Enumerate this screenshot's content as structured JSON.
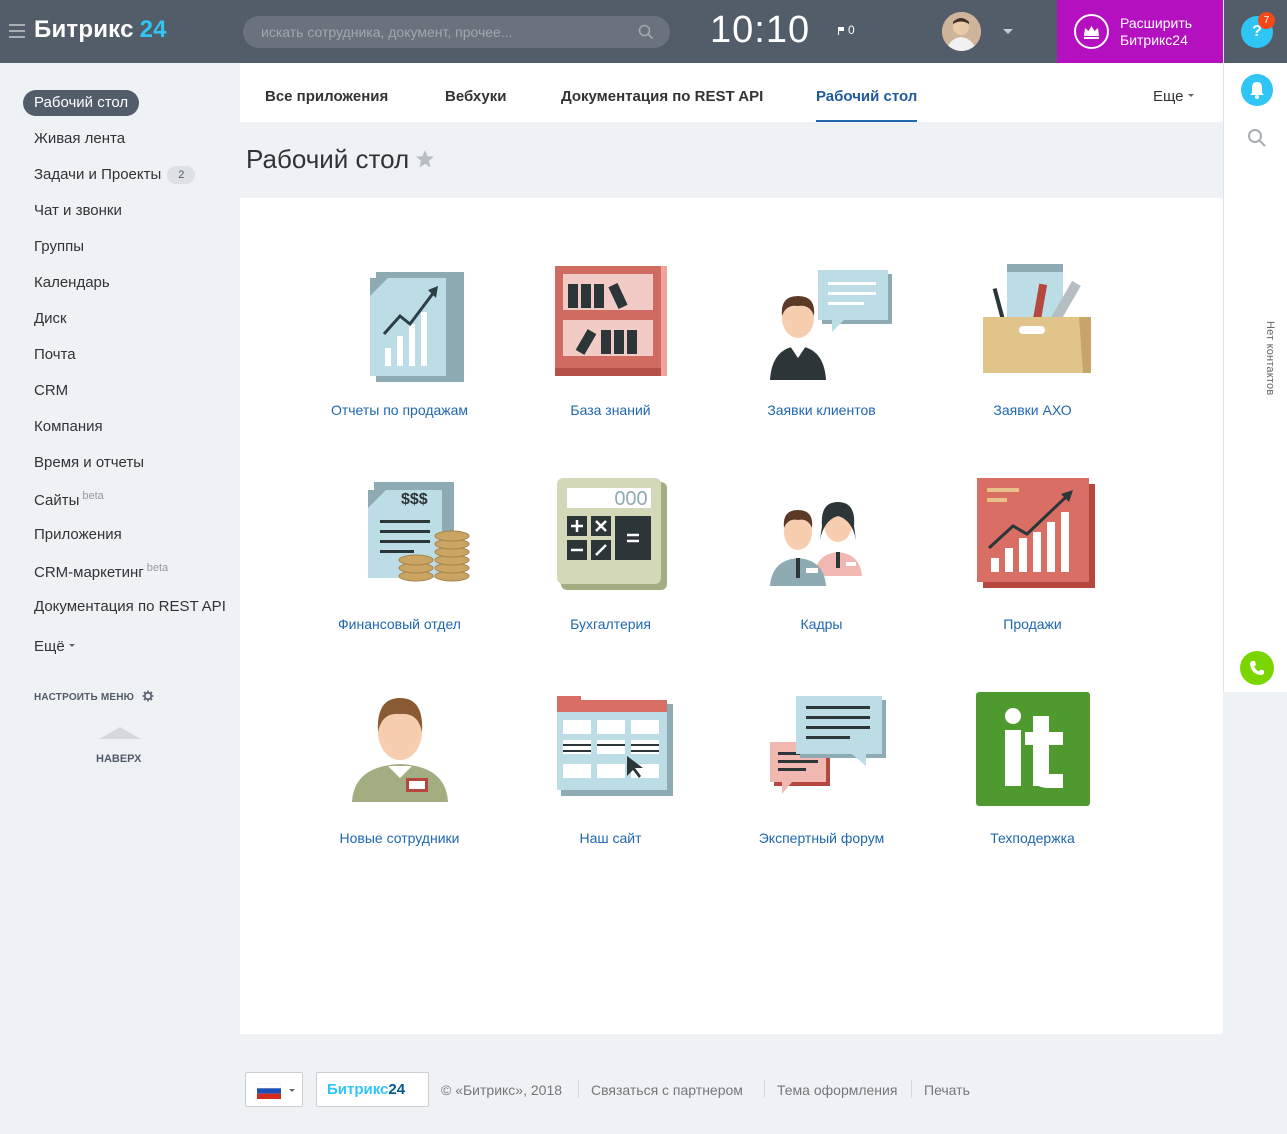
{
  "header": {
    "logo_main": "Битрикс",
    "logo_num": "24",
    "search_placeholder": "искать сотрудника, документ, прочее...",
    "clock": "10:10",
    "flag_count": "0",
    "upgrade_line1": "Расширить",
    "upgrade_line2": "Битрикс24"
  },
  "rail": {
    "help": "?",
    "help_badge": "7",
    "no_contacts": "Нет контактов"
  },
  "sidebar": {
    "items": [
      {
        "label": "Рабочий стол"
      },
      {
        "label": "Живая лента"
      },
      {
        "label": "Задачи и Проекты",
        "count": "2"
      },
      {
        "label": "Чат и звонки"
      },
      {
        "label": "Группы"
      },
      {
        "label": "Календарь"
      },
      {
        "label": "Диск"
      },
      {
        "label": "Почта"
      },
      {
        "label": "CRM"
      },
      {
        "label": "Компания"
      },
      {
        "label": "Время и отчеты"
      },
      {
        "label": "Сайты",
        "badge": "beta"
      },
      {
        "label": "Приложения"
      },
      {
        "label": "CRM-маркетинг",
        "badge": "beta"
      },
      {
        "label": "Документация по REST API"
      }
    ],
    "more": "Ещё",
    "configure": "НАСТРОИТЬ МЕНЮ",
    "up": "НАВЕРХ"
  },
  "tabs": {
    "items": [
      "Все приложения",
      "Вебхуки",
      "Документация по REST API",
      "Рабочий стол"
    ],
    "active": "Рабочий стол",
    "more": "Еще"
  },
  "page": {
    "title": "Рабочий стол"
  },
  "apps": [
    {
      "label": "Отчеты по продажам",
      "icon": "sales-report-icon"
    },
    {
      "label": "База знаний",
      "icon": "knowledge-base-icon"
    },
    {
      "label": "Заявки клиентов",
      "icon": "client-requests-icon"
    },
    {
      "label": "Заявки АХО",
      "icon": "aho-requests-icon"
    },
    {
      "label": "Финансовый отдел",
      "icon": "finance-icon"
    },
    {
      "label": "Бухгалтерия",
      "icon": "calculator-icon"
    },
    {
      "label": "Кадры",
      "icon": "hr-icon"
    },
    {
      "label": "Продажи",
      "icon": "sales-icon"
    },
    {
      "label": "Новые сотрудники",
      "icon": "new-employee-icon"
    },
    {
      "label": "Наш сайт",
      "icon": "website-icon"
    },
    {
      "label": "Экспертный форум",
      "icon": "forum-icon"
    },
    {
      "label": "Техподержка",
      "icon": "it-support-icon"
    }
  ],
  "footer": {
    "logo_main": "Битрикс",
    "logo_num": "24",
    "copyright": "© «Битрикс», 2018",
    "partner": "Связаться с партнером",
    "theme": "Тема оформления",
    "print": "Печать"
  }
}
